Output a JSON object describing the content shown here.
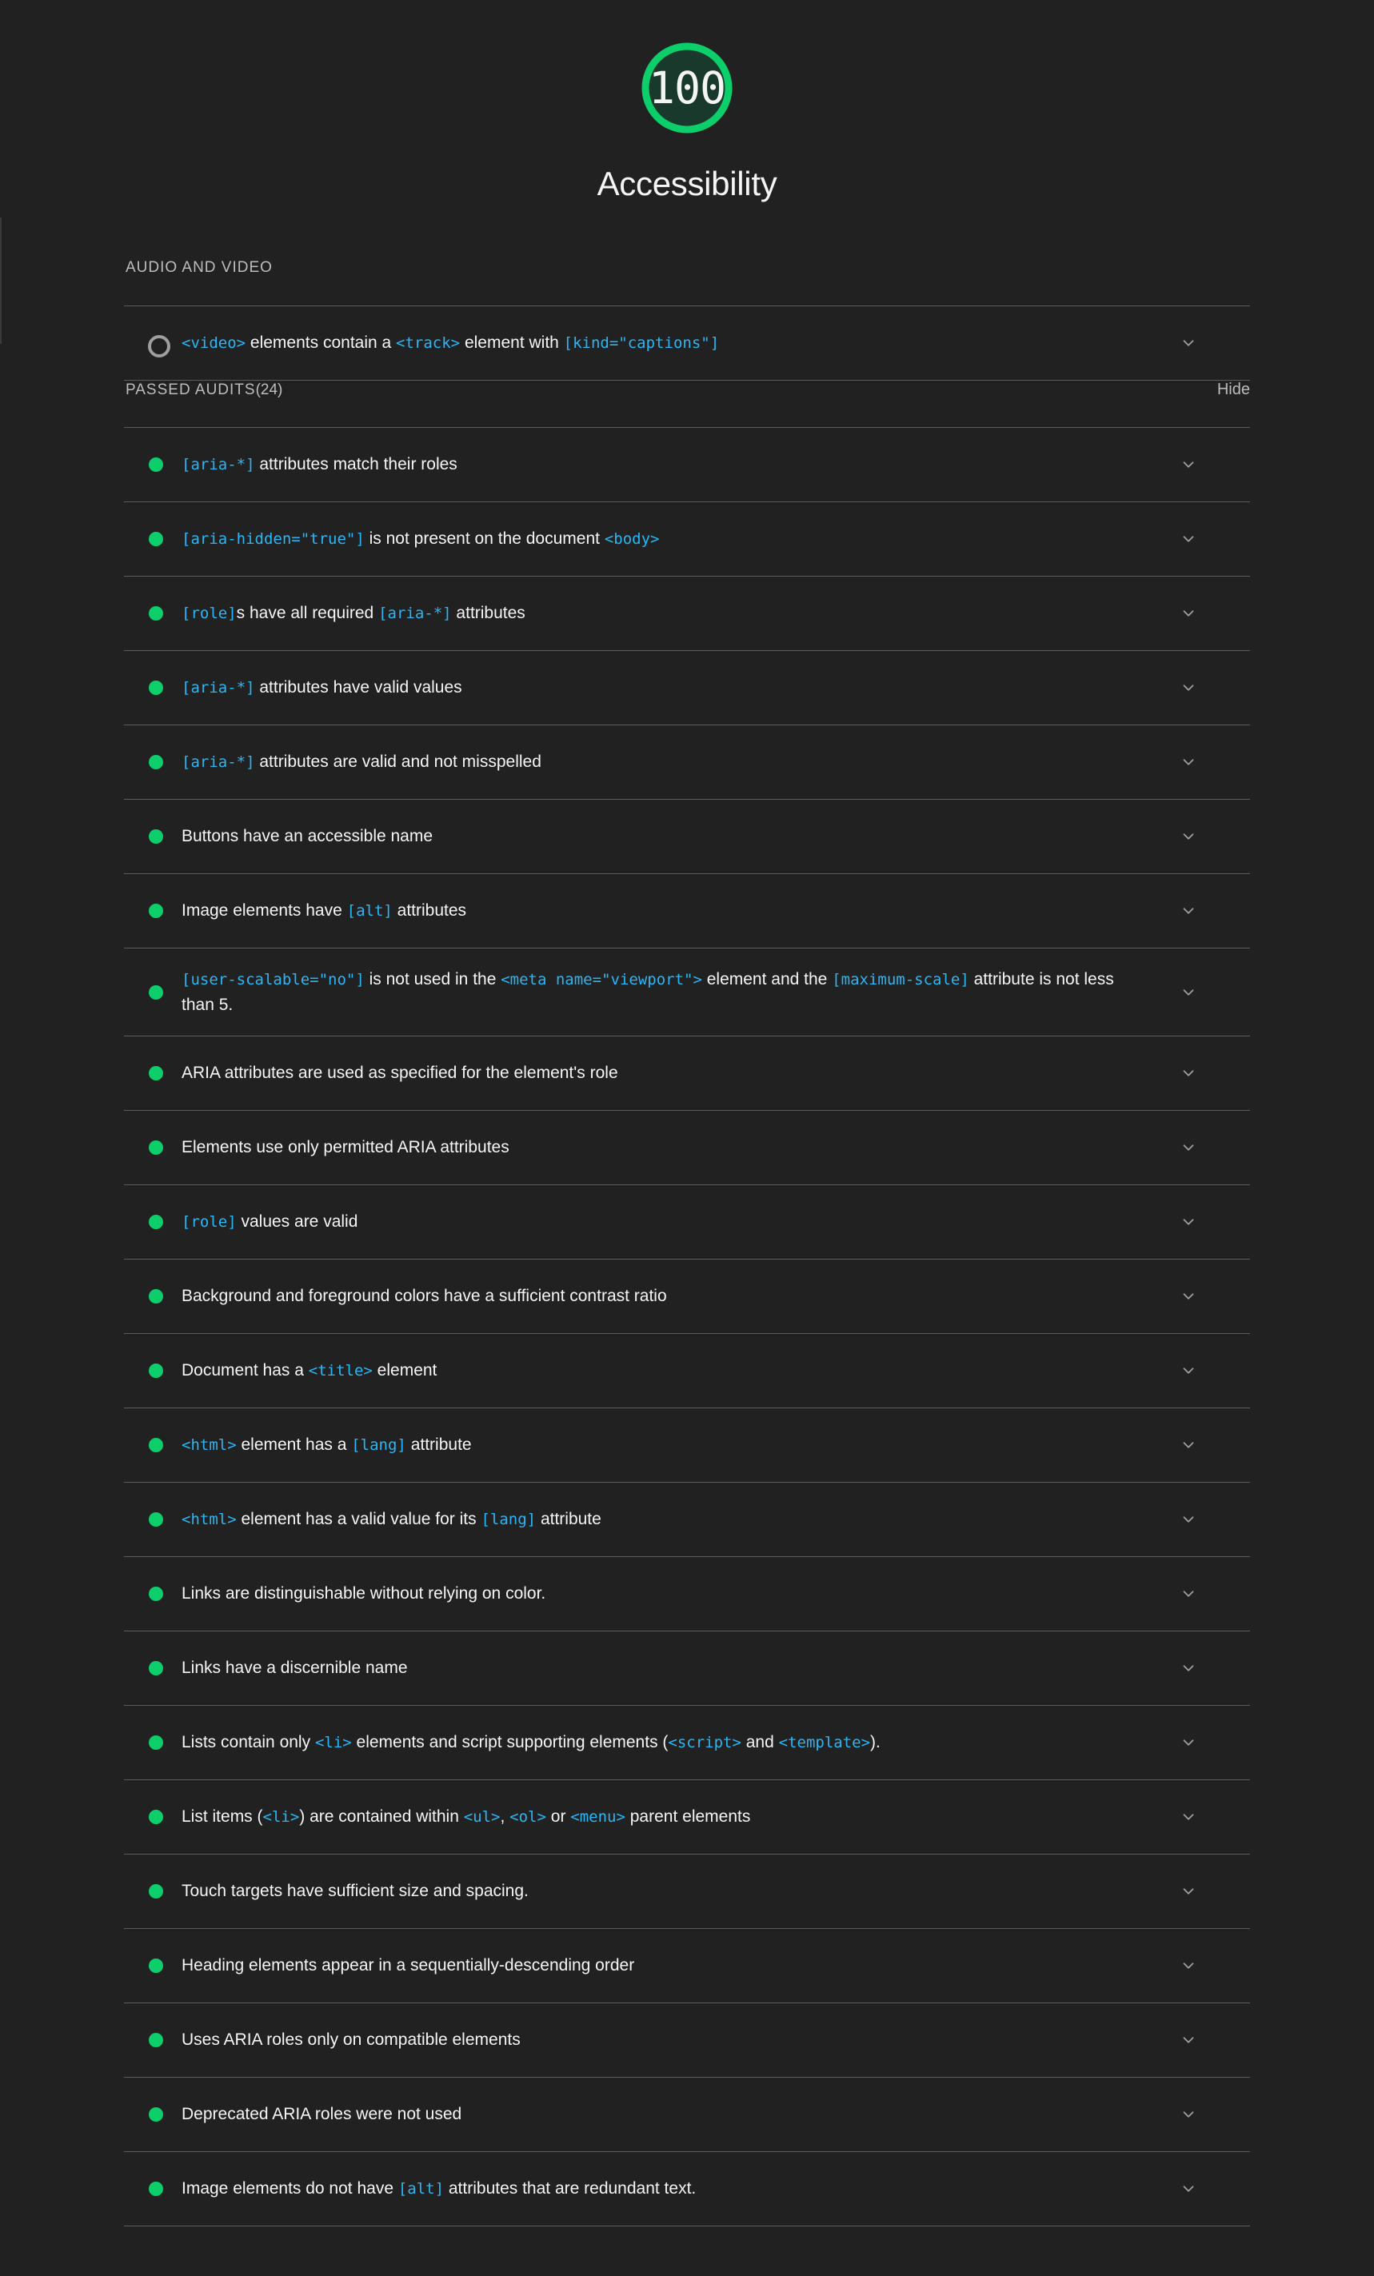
{
  "score": {
    "value": "100",
    "category_title": "Accessibility",
    "color": "#0cce6b",
    "gauge_fill": "#18392b"
  },
  "sections": [
    {
      "id": "audio-and-video",
      "title": "AUDIO AND VIDEO",
      "count_label": "",
      "toggle_label": "",
      "audits": [
        {
          "status": "na",
          "parts": [
            {
              "t": "code",
              "v": "<video>"
            },
            {
              "t": "text",
              "v": " elements contain a "
            },
            {
              "t": "code",
              "v": "<track>"
            },
            {
              "t": "text",
              "v": " element with "
            },
            {
              "t": "code",
              "v": "[kind=\"captions\"]"
            }
          ]
        }
      ]
    },
    {
      "id": "passed-audits",
      "title": "PASSED AUDITS",
      "count_label": "(24)",
      "toggle_label": "Hide",
      "audits": [
        {
          "status": "pass",
          "parts": [
            {
              "t": "code",
              "v": "[aria-*]"
            },
            {
              "t": "text",
              "v": " attributes match their roles"
            }
          ]
        },
        {
          "status": "pass",
          "parts": [
            {
              "t": "code",
              "v": "[aria-hidden=\"true\"]"
            },
            {
              "t": "text",
              "v": " is not present on the document "
            },
            {
              "t": "code",
              "v": "<body>"
            }
          ]
        },
        {
          "status": "pass",
          "parts": [
            {
              "t": "code",
              "v": "[role]"
            },
            {
              "t": "text",
              "v": "s have all required "
            },
            {
              "t": "code",
              "v": "[aria-*]"
            },
            {
              "t": "text",
              "v": " attributes"
            }
          ]
        },
        {
          "status": "pass",
          "parts": [
            {
              "t": "code",
              "v": "[aria-*]"
            },
            {
              "t": "text",
              "v": " attributes have valid values"
            }
          ]
        },
        {
          "status": "pass",
          "parts": [
            {
              "t": "code",
              "v": "[aria-*]"
            },
            {
              "t": "text",
              "v": " attributes are valid and not misspelled"
            }
          ]
        },
        {
          "status": "pass",
          "parts": [
            {
              "t": "text",
              "v": "Buttons have an accessible name"
            }
          ]
        },
        {
          "status": "pass",
          "parts": [
            {
              "t": "text",
              "v": "Image elements have "
            },
            {
              "t": "code",
              "v": "[alt]"
            },
            {
              "t": "text",
              "v": " attributes"
            }
          ]
        },
        {
          "status": "pass",
          "tall": true,
          "parts": [
            {
              "t": "code",
              "v": "[user-scalable=\"no\"]"
            },
            {
              "t": "text",
              "v": " is not used in the "
            },
            {
              "t": "code",
              "v": "<meta name=\"viewport\">"
            },
            {
              "t": "text",
              "v": " element and the "
            },
            {
              "t": "code",
              "v": "[maximum-scale]"
            },
            {
              "t": "text",
              "v": " attribute is not less than 5."
            }
          ]
        },
        {
          "status": "pass",
          "parts": [
            {
              "t": "text",
              "v": "ARIA attributes are used as specified for the element's role"
            }
          ]
        },
        {
          "status": "pass",
          "parts": [
            {
              "t": "text",
              "v": "Elements use only permitted ARIA attributes"
            }
          ]
        },
        {
          "status": "pass",
          "parts": [
            {
              "t": "code",
              "v": "[role]"
            },
            {
              "t": "text",
              "v": " values are valid"
            }
          ]
        },
        {
          "status": "pass",
          "parts": [
            {
              "t": "text",
              "v": "Background and foreground colors have a sufficient contrast ratio"
            }
          ]
        },
        {
          "status": "pass",
          "parts": [
            {
              "t": "text",
              "v": "Document has a "
            },
            {
              "t": "code",
              "v": "<title>"
            },
            {
              "t": "text",
              "v": " element"
            }
          ]
        },
        {
          "status": "pass",
          "parts": [
            {
              "t": "code",
              "v": "<html>"
            },
            {
              "t": "text",
              "v": " element has a "
            },
            {
              "t": "code",
              "v": "[lang]"
            },
            {
              "t": "text",
              "v": " attribute"
            }
          ]
        },
        {
          "status": "pass",
          "parts": [
            {
              "t": "code",
              "v": "<html>"
            },
            {
              "t": "text",
              "v": " element has a valid value for its "
            },
            {
              "t": "code",
              "v": "[lang]"
            },
            {
              "t": "text",
              "v": " attribute"
            }
          ]
        },
        {
          "status": "pass",
          "parts": [
            {
              "t": "text",
              "v": "Links are distinguishable without relying on color."
            }
          ]
        },
        {
          "status": "pass",
          "parts": [
            {
              "t": "text",
              "v": "Links have a discernible name"
            }
          ]
        },
        {
          "status": "pass",
          "parts": [
            {
              "t": "text",
              "v": "Lists contain only "
            },
            {
              "t": "code",
              "v": "<li>"
            },
            {
              "t": "text",
              "v": " elements and script supporting elements ("
            },
            {
              "t": "code",
              "v": "<script>"
            },
            {
              "t": "text",
              "v": " and "
            },
            {
              "t": "code",
              "v": "<template>"
            },
            {
              "t": "text",
              "v": ")."
            }
          ]
        },
        {
          "status": "pass",
          "parts": [
            {
              "t": "text",
              "v": "List items ("
            },
            {
              "t": "code",
              "v": "<li>"
            },
            {
              "t": "text",
              "v": ") are contained within "
            },
            {
              "t": "code",
              "v": "<ul>"
            },
            {
              "t": "text",
              "v": ", "
            },
            {
              "t": "code",
              "v": "<ol>"
            },
            {
              "t": "text",
              "v": " or "
            },
            {
              "t": "code",
              "v": "<menu>"
            },
            {
              "t": "text",
              "v": " parent elements"
            }
          ]
        },
        {
          "status": "pass",
          "parts": [
            {
              "t": "text",
              "v": "Touch targets have sufficient size and spacing."
            }
          ]
        },
        {
          "status": "pass",
          "parts": [
            {
              "t": "text",
              "v": "Heading elements appear in a sequentially-descending order"
            }
          ]
        },
        {
          "status": "pass",
          "parts": [
            {
              "t": "text",
              "v": "Uses ARIA roles only on compatible elements"
            }
          ]
        },
        {
          "status": "pass",
          "parts": [
            {
              "t": "text",
              "v": "Deprecated ARIA roles were not used"
            }
          ]
        },
        {
          "status": "pass",
          "parts": [
            {
              "t": "text",
              "v": "Image elements do not have "
            },
            {
              "t": "code",
              "v": "[alt]"
            },
            {
              "t": "text",
              "v": " attributes that are redundant text."
            }
          ]
        }
      ]
    }
  ]
}
